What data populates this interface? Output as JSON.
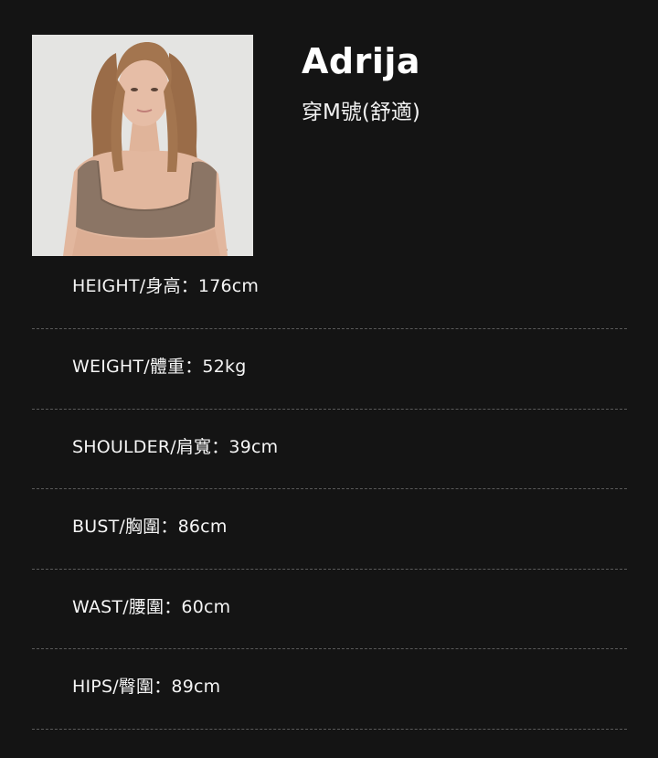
{
  "model": {
    "name": "Adrija",
    "size_note": "穿M號(舒適)"
  },
  "measurements": [
    "HEIGHT/身高：176cm",
    "WEIGHT/體重：52kg",
    "SHOULDER/肩寬：39cm",
    "BUST/胸圍：86cm",
    "WAST/腰圍：60cm",
    "HIPS/臀圍：89cm"
  ],
  "colors": {
    "background": "#141414",
    "text": "#ffffff",
    "divider": "#5a5a5a",
    "photo_background": "#e3e3e3",
    "garment": "#8b7565"
  }
}
